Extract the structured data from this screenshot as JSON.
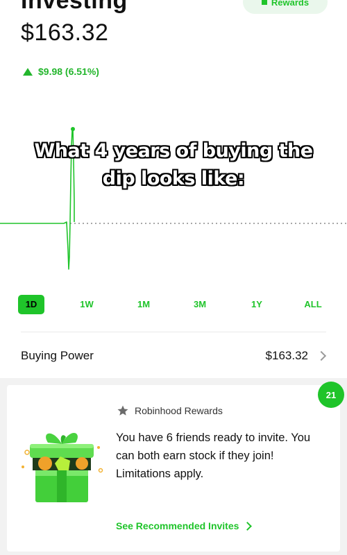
{
  "header": {
    "title": "Investing",
    "rewards_button": "Rewards"
  },
  "portfolio": {
    "balance": "$163.32",
    "change": "$9.98 (6.51%)",
    "change_direction": "up",
    "accent_color": "#1fc42a"
  },
  "overlay_caption": {
    "line1": "What 4 years of buying the",
    "line2": "dip looks like:"
  },
  "time_ranges": [
    {
      "label": "1D",
      "active": true
    },
    {
      "label": "1W",
      "active": false
    },
    {
      "label": "1M",
      "active": false
    },
    {
      "label": "3M",
      "active": false
    },
    {
      "label": "1Y",
      "active": false
    },
    {
      "label": "ALL",
      "active": false
    }
  ],
  "buying_power": {
    "label": "Buying Power",
    "value": "$163.32"
  },
  "rewards_card": {
    "badge_count": "21",
    "heading": "Robinhood Rewards",
    "message": "You have 6 friends ready to invite. You can both earn stock if they join! Limitations apply.",
    "cta": "See Recommended Invites",
    "icon": "gift-box-illustration"
  }
}
